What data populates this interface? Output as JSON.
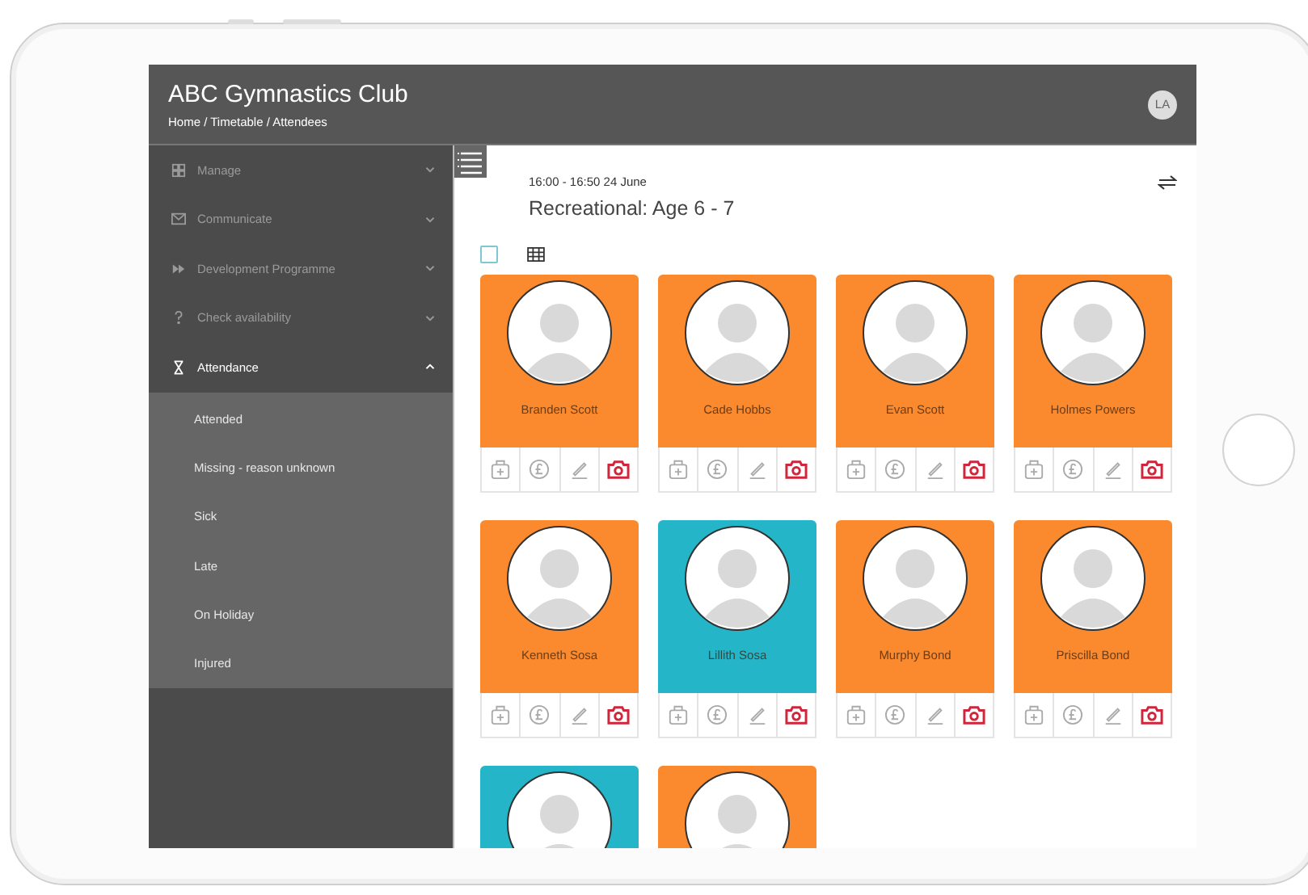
{
  "header": {
    "title": "ABC Gymnastics Club",
    "breadcrumb": "Home / Timetable / Attendees",
    "avatar": "LA"
  },
  "sidebar": {
    "items": [
      {
        "label": "Manage",
        "expanded": false
      },
      {
        "label": "Communicate",
        "expanded": false
      },
      {
        "label": "Development Programme",
        "expanded": false
      },
      {
        "label": "Check availability",
        "expanded": false
      },
      {
        "label": "Attendance",
        "expanded": true,
        "children": [
          {
            "label": "Attended"
          },
          {
            "label": "Missing - reason unknown"
          },
          {
            "label": "Sick"
          },
          {
            "label": "Late"
          },
          {
            "label": "On Holiday"
          },
          {
            "label": "Injured"
          }
        ]
      }
    ]
  },
  "session": {
    "time": "16:00 - 16:50  24 June",
    "title": "Recreational: Age 6 - 7"
  },
  "select_all": {
    "checked": false
  },
  "cards": [
    {
      "name": "Branden Scott",
      "color": "#fb8a2e"
    },
    {
      "name": "Cade Hobbs",
      "color": "#fb8a2e"
    },
    {
      "name": "Evan Scott",
      "color": "#fb8a2e"
    },
    {
      "name": "Holmes Powers",
      "color": "#fb8a2e"
    },
    {
      "name": "Kenneth Sosa",
      "color": "#fb8a2e"
    },
    {
      "name": "Lillith Sosa",
      "color": "#25b5c8"
    },
    {
      "name": "Murphy Bond",
      "color": "#fb8a2e"
    },
    {
      "name": "Priscilla Bond",
      "color": "#fb8a2e"
    },
    {
      "color": "#25b5c8"
    },
    {
      "color": "#fb8a2e"
    }
  ]
}
